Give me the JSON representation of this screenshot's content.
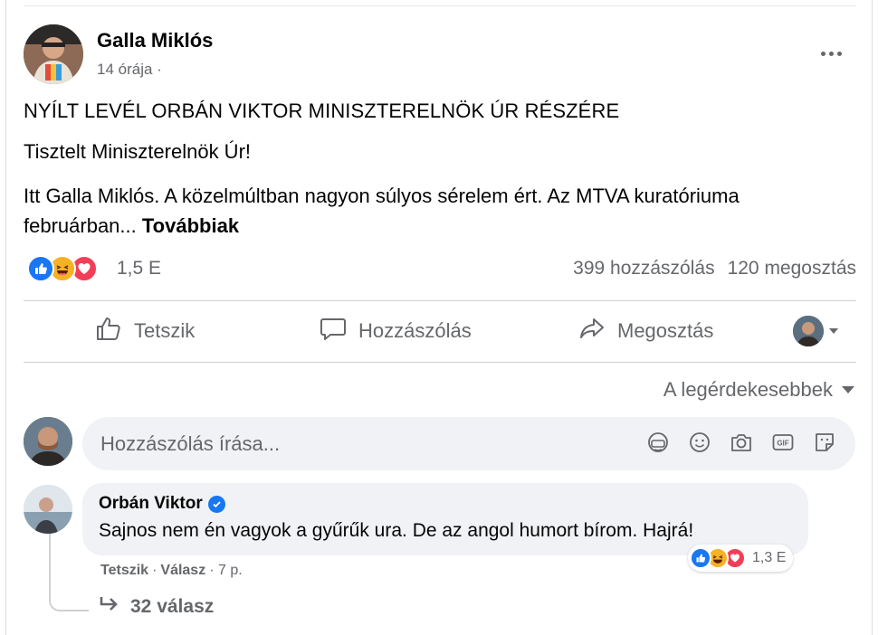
{
  "post": {
    "author": "Galla Miklós",
    "time": "14 órája ·",
    "more_icon": "more-horizontal-icon",
    "title": "NYÍLT LEVÉL ORBÁN VIKTOR MINISZTERELNÖK ÚR RÉSZÉRE",
    "greeting": "Tisztelt Miniszterelnök Úr!",
    "body": "Itt Galla Miklós. A közelmúltban nagyon súlyos sérelem ért. Az MTVA kuratóriuma februárban...",
    "more_link": "Továbbiak"
  },
  "stats": {
    "reaction_icons": [
      "like-icon",
      "haha-icon",
      "love-icon"
    ],
    "reaction_count": "1,5 E",
    "comments": "399 hozzászólás",
    "shares": "120 megosztás"
  },
  "actions": {
    "like": "Tetszik",
    "comment": "Hozzászólás",
    "share": "Megosztás"
  },
  "sort": {
    "label": "A legérdekesebbek"
  },
  "composer": {
    "placeholder": "Hozzászólás írása...",
    "icons": [
      "avatar-sticker-icon",
      "emoji-icon",
      "camera-icon",
      "gif-icon",
      "sticker-icon"
    ]
  },
  "comment": {
    "author": "Orbán Viktor",
    "text": "Sajnos nem én vagyok a gyűrűk ura. De az angol humort bírom. Hajrá!",
    "reaction_count": "1,3 E",
    "like": "Tetszik",
    "separator": "·",
    "reply": "Válasz",
    "time": "· 7 p."
  },
  "replies": {
    "label": "32 válasz"
  },
  "colors": {
    "accent": "#1877f2",
    "secondary_text": "#65676b",
    "bubble": "#f0f2f5",
    "haha": "#f7b125",
    "love": "#f33e58"
  }
}
